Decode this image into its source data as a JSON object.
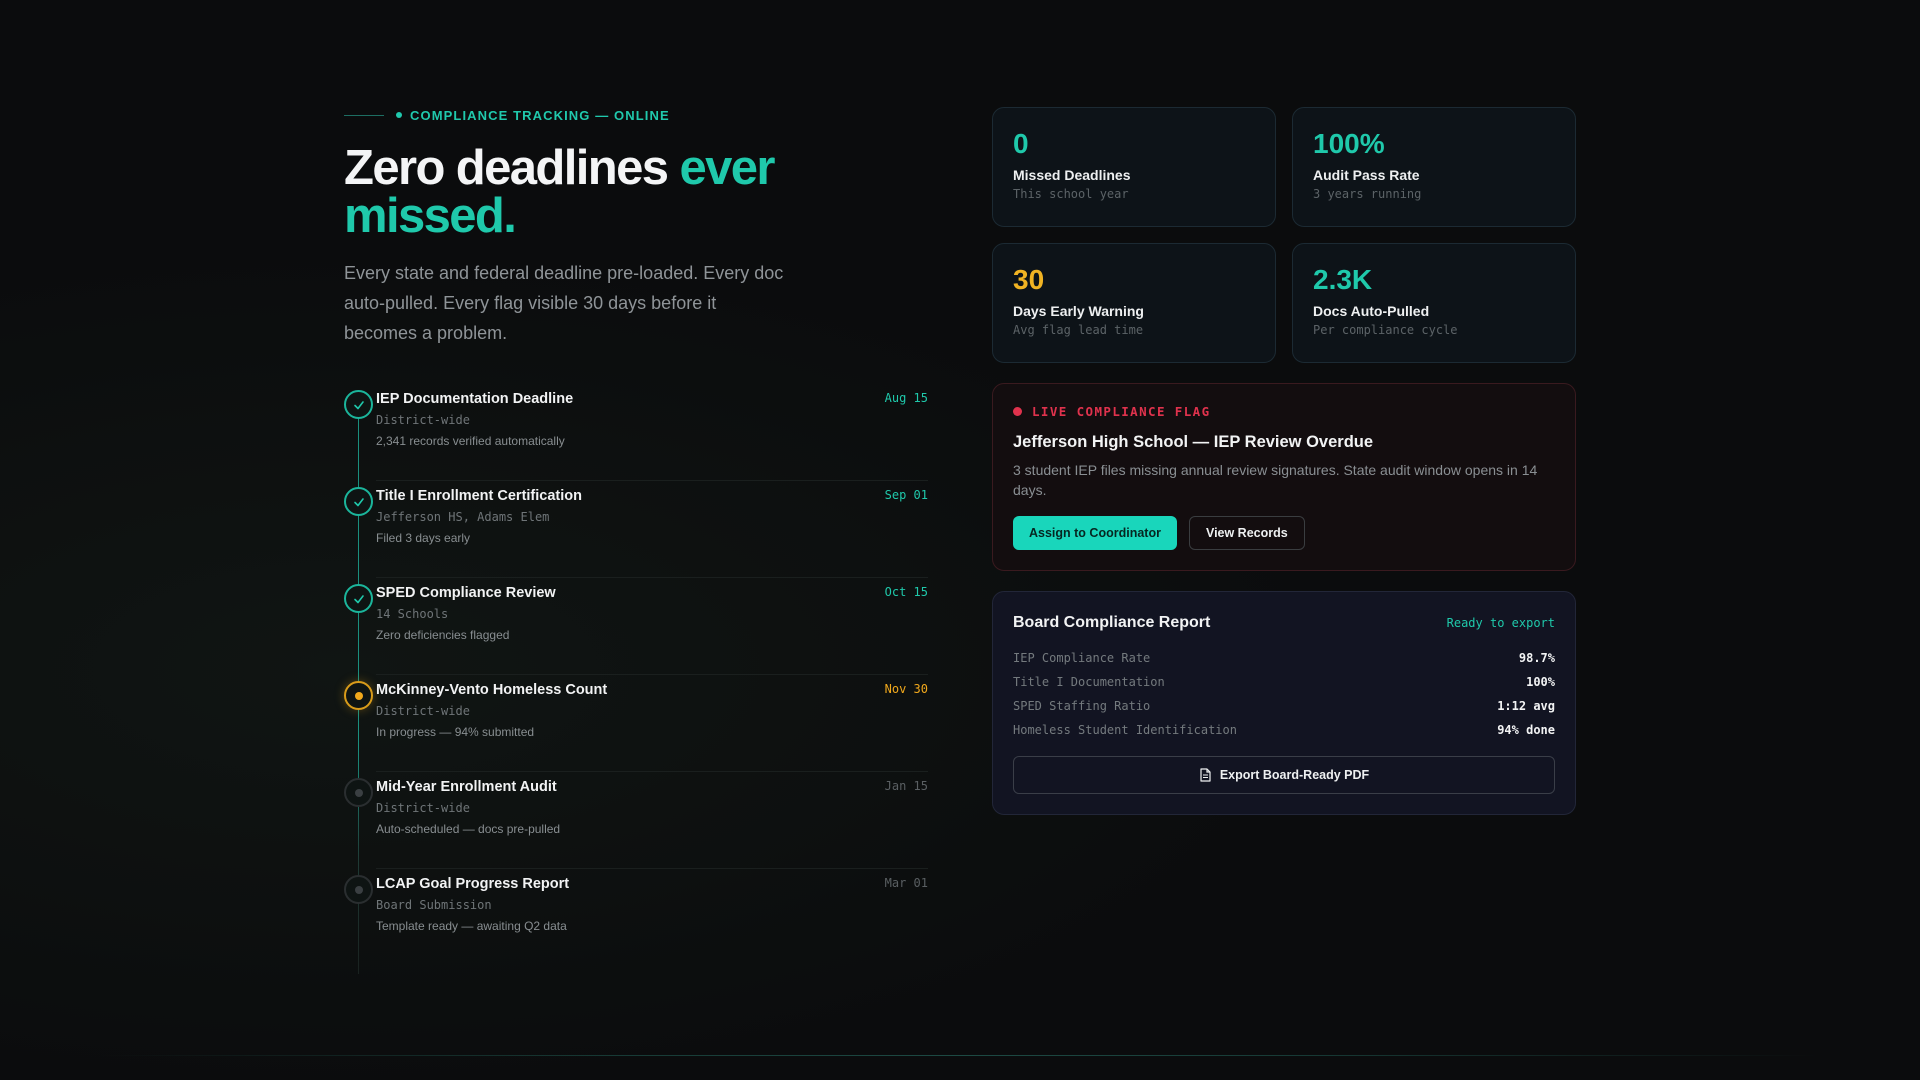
{
  "eyebrow": "COMPLIANCE TRACKING — ONLINE",
  "headline": {
    "part1": "Zero deadlines ",
    "accent1": "ever",
    "accent2": "missed."
  },
  "lede": "Every state and federal deadline pre-loaded. Every doc auto-pulled. Every flag visible 30 days before it becomes a problem.",
  "timeline": [
    {
      "title": "IEP Documentation Deadline",
      "scope": "District-wide",
      "note": "2,341 records verified automatically",
      "date": "Aug 15",
      "status": "done"
    },
    {
      "title": "Title I Enrollment Certification",
      "scope": "Jefferson HS, Adams Elem",
      "note": "Filed 3 days early",
      "date": "Sep 01",
      "status": "done"
    },
    {
      "title": "SPED Compliance Review",
      "scope": "14 Schools",
      "note": "Zero deficiencies flagged",
      "date": "Oct 15",
      "status": "done"
    },
    {
      "title": "McKinney-Vento Homeless Count",
      "scope": "District-wide",
      "note": "In progress — 94% submitted",
      "date": "Nov 30",
      "status": "in-progress"
    },
    {
      "title": "Mid-Year Enrollment Audit",
      "scope": "District-wide",
      "note": "Auto-scheduled — docs pre-pulled",
      "date": "Jan 15",
      "status": "upcoming"
    },
    {
      "title": "LCAP Goal Progress Report",
      "scope": "Board Submission",
      "note": "Template ready — awaiting Q2 data",
      "date": "Mar 01",
      "status": "upcoming"
    }
  ],
  "stats": [
    {
      "value": "0",
      "label": "Missed Deadlines",
      "caption": "This school year"
    },
    {
      "value": "100%",
      "label": "Audit Pass Rate",
      "caption": "3 years running"
    },
    {
      "value": "30",
      "label": "Days Early Warning",
      "caption": "Avg flag lead time"
    },
    {
      "value": "2.3K",
      "label": "Docs Auto-Pulled",
      "caption": "Per compliance cycle"
    }
  ],
  "flag": {
    "tag": "LIVE COMPLIANCE FLAG",
    "title": "Jefferson High School — IEP Review Overdue",
    "description": "3 student IEP files missing annual review signatures. State audit window opens in 14 days.",
    "primary_action": "Assign to Coordinator",
    "secondary_action": "View Records"
  },
  "report": {
    "title": "Board Compliance Report",
    "status": "Ready to export",
    "rows": [
      {
        "label": "IEP Compliance Rate",
        "value": "98.7%"
      },
      {
        "label": "Title I Documentation",
        "value": "100%"
      },
      {
        "label": "SPED Staffing Ratio",
        "value": "1:12 avg"
      },
      {
        "label": "Homeless Student Identification",
        "value": "94% done"
      }
    ],
    "export_label": "Export Board-Ready PDF"
  },
  "colors": {
    "accent": "#1fc9ab",
    "warning": "#f0b323",
    "danger": "#e0324d",
    "background": "#0b0c0d"
  },
  "icons": {
    "done": "check-icon",
    "in_progress": "dot-icon",
    "upcoming": "dot-icon",
    "export": "document-icon"
  }
}
